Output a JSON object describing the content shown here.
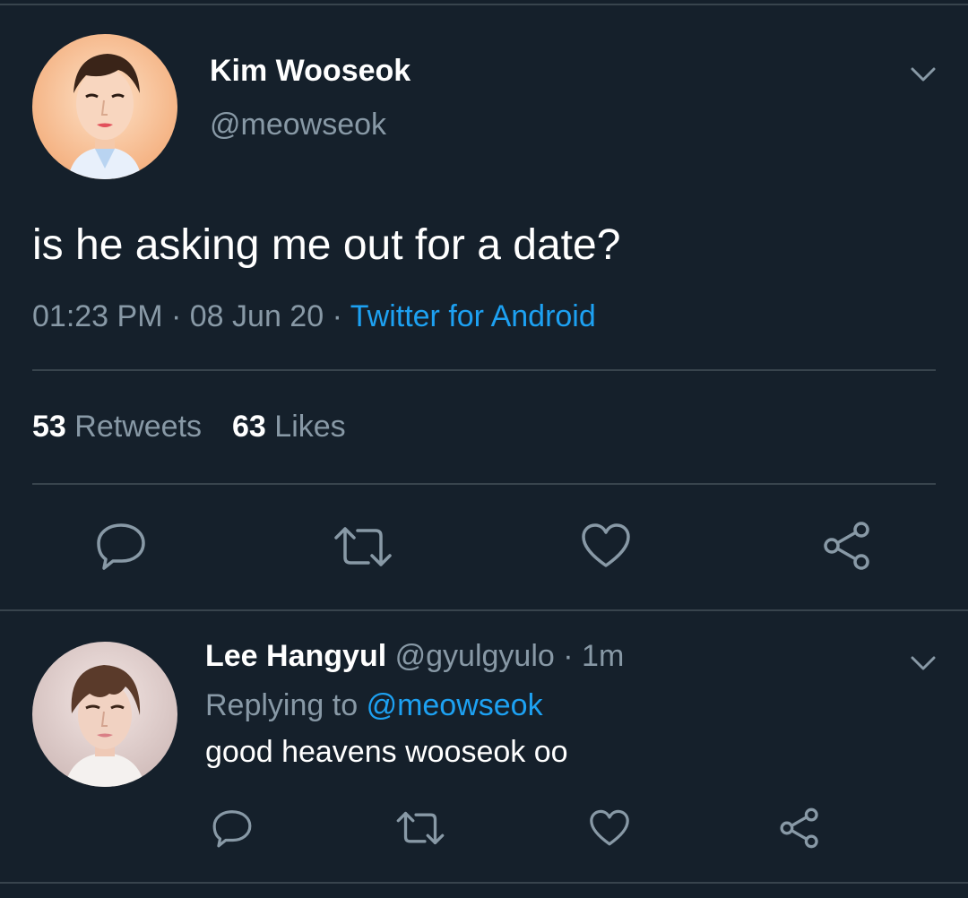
{
  "main_tweet": {
    "author_name": "Kim Wooseok",
    "author_handle": "@meowseok",
    "text": "is he asking me out for a date?",
    "time": "01:23 PM",
    "date": "08 Jun 20",
    "separator": "·",
    "source": "Twitter for Android",
    "retweet_count": "53",
    "retweet_label": "Retweets",
    "like_count": "63",
    "like_label": "Likes",
    "avatar_icon": "avatar-photo",
    "menu_icon": "chevron-down-icon",
    "actions": [
      "reply-icon",
      "retweet-icon",
      "like-icon",
      "share-icon"
    ]
  },
  "reply_tweet": {
    "author_name": "Lee Hangyul",
    "author_handle": "@gyulgyulo",
    "separator": "·",
    "time": "1m",
    "replying_label": "Replying to",
    "replying_to": "@meowseok",
    "text": "good heavens wooseok oo",
    "avatar_icon": "avatar-photo",
    "menu_icon": "chevron-down-icon",
    "actions": [
      "reply-icon",
      "retweet-icon",
      "like-icon",
      "share-icon"
    ]
  },
  "colors": {
    "background": "#15202b",
    "text": "#ffffff",
    "secondary_text": "#8899a6",
    "link": "#1da1f2",
    "divider": "#38444d"
  }
}
